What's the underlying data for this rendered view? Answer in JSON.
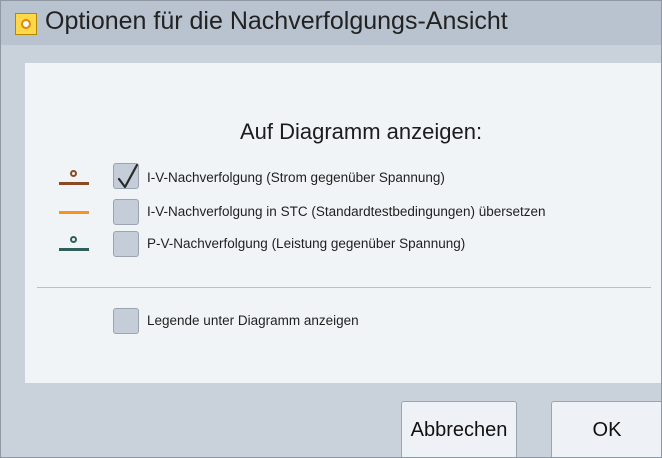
{
  "window": {
    "title": "Optionen für die Nachverfolgungs-Ansicht",
    "icon": "app-sun-icon"
  },
  "section": {
    "heading": "Auf Diagramm anzeigen:"
  },
  "options": [
    {
      "label": "I-V-Nachverfolgung (Strom gegenüber Spannung)",
      "checked": true,
      "legend_color": "#8b4a22",
      "legend_dot": true
    },
    {
      "label": "I-V-Nachverfolgung in STC (Standardtestbedingungen) übersetzen",
      "checked": false,
      "legend_color": "#f7941d",
      "legend_dot": false
    },
    {
      "label": "P-V-Nachverfolgung (Leistung gegenüber Spannung)",
      "checked": false,
      "legend_color": "#2f5f5a",
      "legend_dot": true
    }
  ],
  "legend_option": {
    "label": "Legende unter Diagramm anzeigen",
    "checked": false
  },
  "buttons": {
    "cancel": "Abbrechen",
    "ok": "OK"
  },
  "colors": {
    "background": "#c9d1db",
    "panel": "#f1f4f7",
    "checkbox": "#c5ced8",
    "button": "#eef2f6"
  }
}
